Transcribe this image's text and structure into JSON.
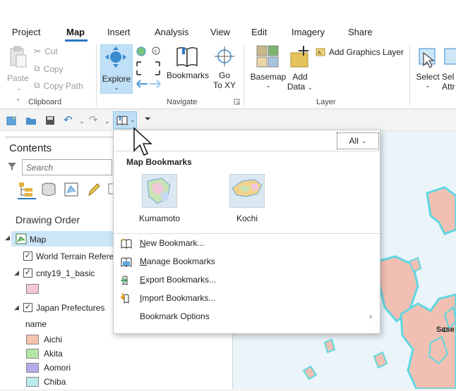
{
  "tabs": [
    "Project",
    "Map",
    "Insert",
    "Analysis",
    "View",
    "Edit",
    "Imagery",
    "Share"
  ],
  "active_tab": "Map",
  "clipboard": {
    "paste_label": "Paste",
    "cut_label": "Cut",
    "copy_label": "Copy",
    "copy_path_label": "Copy Path",
    "group_label": "Clipboard"
  },
  "navigate": {
    "explore_label": "Explore",
    "bookmarks_label": "Bookmarks",
    "goto_label_1": "Go",
    "goto_label_2": "To XY",
    "group_label": "Navigate"
  },
  "layer": {
    "basemap_label": "Basemap",
    "add_label": "Add",
    "data_label": "Data",
    "add_graphics_label": "Add Graphics Layer",
    "group_label": "Layer"
  },
  "selection": {
    "select_label": "Select",
    "select_by_attr_label_1": "Sel",
    "select_by_attr_label_2": "Attr"
  },
  "contents": {
    "title": "Contents",
    "search_placeholder": "Search",
    "drawing_order_label": "Drawing Order",
    "layers": {
      "map": "Map",
      "world_terrain": "World Terrain Refere",
      "cnty": "cnty19_1_basic",
      "japan": "Japan Prefectures"
    },
    "field_label": "name",
    "legend": [
      {
        "name": "Aichi",
        "color": "#f5c2ae"
      },
      {
        "name": "Akita",
        "color": "#b5e6a5"
      },
      {
        "name": "Aomori",
        "color": "#b4acea"
      },
      {
        "name": "Chiba",
        "color": "#b8ecef"
      }
    ],
    "cnty_color": "#f3c6d8"
  },
  "bookmarks_dropdown": {
    "filter_label": "All",
    "section_title": "Map Bookmarks",
    "bookmarks": [
      {
        "name": "Kumamoto"
      },
      {
        "name": "Kochi"
      }
    ],
    "menu": {
      "new": "New Bookmark...",
      "manage": "Manage Bookmarks",
      "export": "Export Bookmarks...",
      "import": "Import Bookmarks...",
      "options": "Bookmark Options"
    }
  },
  "map_labels": {
    "city": "Sase"
  },
  "colors": {
    "accent": "#2b78c2",
    "explore_bg": "#bfe0f6",
    "land": "#f2c0b2",
    "coast": "#5fd7e0",
    "water": "#eaf4f9"
  }
}
